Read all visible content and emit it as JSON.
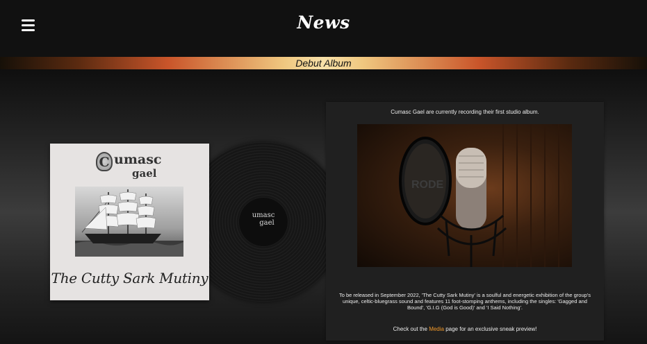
{
  "header": {
    "title": "News",
    "menu_icon": "hamburger-menu-icon"
  },
  "banner": {
    "label": "Debut Album"
  },
  "album_art": {
    "band_name_line1": "umasc",
    "band_initial": "C",
    "band_name_line2": "gael",
    "album_title": "The Cutty Sark Mutiny",
    "vinyl_label_line1": "umasc",
    "vinyl_label_line2": "gael"
  },
  "info": {
    "intro": "Cumasc Gael are currently recording their first studio album.",
    "description": "To be released in September 2022, 'The Cutty Sark Mutiny' is a soulful and energetic exhibition of the group's unique, celtic-bluegrass sound and features 11 foot-stomping anthems, including the singles: 'Gagged and Bound', 'G.I.G (God is Good)' and 'I Said Nothing'.",
    "cta_before": "Check out the ",
    "cta_link": "Media",
    "cta_after": " page for an exclusive sneak preview!",
    "mic_brand": "RODE"
  },
  "colors": {
    "accent_link": "#f39a2a",
    "banner_center": "#f7e0a8",
    "banner_edge": "#c9552a"
  }
}
